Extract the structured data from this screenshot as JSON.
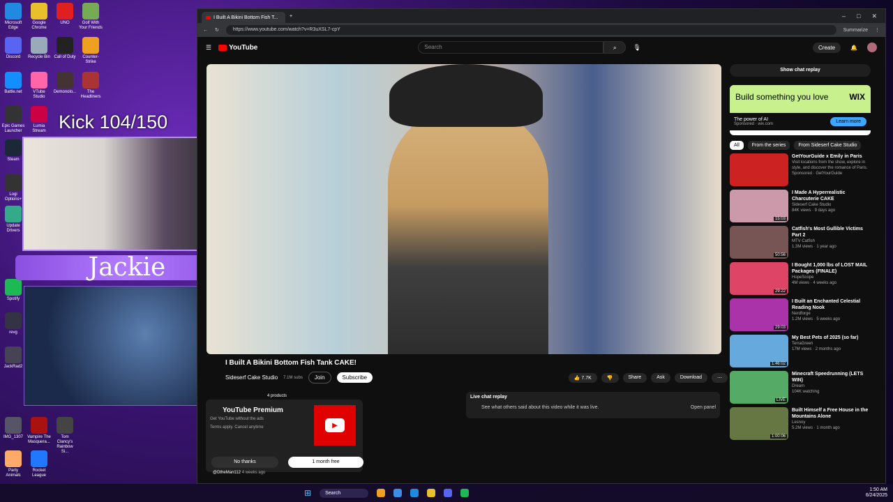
{
  "desktop": {
    "icons": [
      {
        "label": "Microsoft Edge",
        "color": "#1f8ae0"
      },
      {
        "label": "Google Chrome",
        "color": "#e8c02c"
      },
      {
        "label": "UNO",
        "color": "#e02020"
      },
      {
        "label": "Golf With Your Friends",
        "color": "#7a5"
      },
      {
        "label": "Discord",
        "color": "#5865f2"
      },
      {
        "label": "Recycle Bin",
        "color": "#9ab"
      },
      {
        "label": "Call of Duty",
        "color": "#222"
      },
      {
        "label": "Counter-Strike",
        "color": "#f0a020"
      },
      {
        "label": "Battle.net",
        "color": "#148eff"
      },
      {
        "label": "VTube Studio",
        "color": "#f6a"
      },
      {
        "label": "Demonolo...",
        "color": "#433"
      },
      {
        "label": "The Headliners",
        "color": "#a33"
      },
      {
        "label": "Epic Games Launcher",
        "color": "#333"
      },
      {
        "label": "Lumia Stream",
        "color": "#c04"
      },
      {
        "label": "Steam",
        "color": "#1b2838"
      },
      {
        "label": "Logi Options+",
        "color": "#333"
      },
      {
        "label": "Update Drivers",
        "color": "#3a8"
      },
      {
        "label": "Spotify",
        "color": "#1db954"
      },
      {
        "label": "revg",
        "color": "#334"
      },
      {
        "label": "JackRad2",
        "color": "#445"
      },
      {
        "label": "IMG_1307",
        "color": "#556"
      },
      {
        "label": "Vampire The Masquera...",
        "color": "#a11"
      },
      {
        "label": "Tom Clancy's Rainbow Si...",
        "color": "#444"
      },
      {
        "label": "Party Animals",
        "color": "#fa6"
      },
      {
        "label": "Rocket League",
        "color": "#27f"
      }
    ]
  },
  "overlay": {
    "kick_counter": "Kick 104/150",
    "streamer_name": "Jackie"
  },
  "browser": {
    "tab_title": "I Built A Bikini Bottom Fish T...",
    "url": "https://www.youtube.com/watch?v=R3uXSL7-cpY",
    "summarize": "Summarize"
  },
  "youtube": {
    "logo": "YouTube",
    "search_placeholder": "Search",
    "create": "Create",
    "video": {
      "title": "I Built A Bikini Bottom Fish Tank CAKE!",
      "channel": "Sideserf Cake Studio",
      "subs": "7.1M subs",
      "join": "Join",
      "subscribe": "Subscribe",
      "likes": "7.7K",
      "share": "Share",
      "ask": "Ask",
      "download": "Download",
      "products": "4 products"
    },
    "live_chat": {
      "title": "Live chat replay",
      "desc": "See what others said about this video while it was live.",
      "open": "Open panel"
    },
    "premium": {
      "title": "YouTube Premium",
      "line1": "Get YouTube without the ads",
      "line2": "Terms apply. Cancel anytime",
      "no": "No thanks",
      "yes": "1 month free"
    },
    "comment_author": "@DtheMan112",
    "comment_time": "4 weeks ago",
    "show_chat_replay": "Show chat replay",
    "ad": {
      "headline": "Build something you love",
      "brand": "WIX",
      "tagline": "The power of AI",
      "sponsor": "Sponsored · wix.com",
      "cta": "Learn more"
    },
    "chips": [
      "All",
      "From the series",
      "From Sideserf Cake Studio"
    ],
    "recs": [
      {
        "title": "GetYourGuide x Emily in Paris",
        "l1": "Visit locations from the show, explore in style, and discover the romance of Paris.",
        "l2": "Sponsored · GetYourGuide",
        "dur": "",
        "color": "#c22"
      },
      {
        "title": "I Made A Hyperrealistic Charcuterie CAKE",
        "l1": "Sideserf Cake Studio",
        "l2": "84K views · 9 days ago",
        "dur": "15:03",
        "color": "#c9a"
      },
      {
        "title": "Catfish's Most Gullible Victims Part 2",
        "l1": "MTV Catfish",
        "l2": "1.3M views · 1 year ago",
        "dur": "50:56",
        "color": "#755"
      },
      {
        "title": "I Bought 1,000 lbs of LOST MAIL Packages (FINALE)",
        "l1": "HopeScope",
        "l2": "4M views · 4 weeks ago",
        "dur": "29:22",
        "color": "#d46"
      },
      {
        "title": "I Built an Enchanted Celestial Reading Nook",
        "l1": "Nerdforge",
        "l2": "1.2M views · 5 weeks ago",
        "dur": "29:03",
        "color": "#a3a"
      },
      {
        "title": "My Best Pets of 2025 (so far)",
        "l1": "TerraGreen",
        "l2": "17M views · 2 months ago",
        "dur": "1:46:02",
        "color": "#6ad"
      },
      {
        "title": "Minecraft Speedrunning (LETS WIN)",
        "l1": "Dream",
        "l2": "104K watching",
        "dur": "LIVE",
        "color": "#5a6"
      },
      {
        "title": "Built Himself a Free House in the Mountains Alone",
        "l1": "Lesnoy",
        "l2": "5.2M views · 1 month ago",
        "dur": "1:00:06",
        "color": "#674"
      }
    ]
  },
  "taskbar": {
    "search": "Search",
    "time": "1:50 AM",
    "date": "6/24/2025"
  }
}
